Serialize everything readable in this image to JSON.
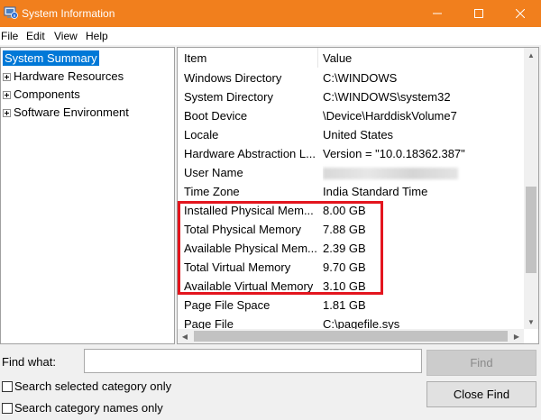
{
  "window": {
    "title": "System Information",
    "controls": {
      "minimize": "—",
      "maximize": "☐",
      "close": "✕"
    }
  },
  "menu": [
    "File",
    "Edit",
    "View",
    "Help"
  ],
  "tree": {
    "selected": "System Summary",
    "children": [
      "Hardware Resources",
      "Components",
      "Software Environment"
    ]
  },
  "table": {
    "columns": [
      "Item",
      "Value"
    ],
    "rows": [
      [
        "Windows Directory",
        "C:\\WINDOWS"
      ],
      [
        "System Directory",
        "C:\\WINDOWS\\system32"
      ],
      [
        "Boot Device",
        "\\Device\\HarddiskVolume7"
      ],
      [
        "Locale",
        "United States"
      ],
      [
        "Hardware Abstraction L...",
        "Version = \"10.0.18362.387\""
      ],
      [
        "User Name",
        ""
      ],
      [
        "Time Zone",
        "India Standard Time"
      ],
      [
        "Installed Physical Mem...",
        "8.00 GB"
      ],
      [
        "Total Physical Memory",
        "7.88 GB"
      ],
      [
        "Available Physical Mem...",
        "2.39 GB"
      ],
      [
        "Total Virtual Memory",
        "9.70 GB"
      ],
      [
        "Available Virtual Memory",
        "3.10 GB"
      ],
      [
        "Page File Space",
        "1.81 GB"
      ],
      [
        "Page File",
        "C:\\pagefile.sys"
      ]
    ],
    "highlight_color": "#e3151e"
  },
  "find": {
    "label": "Find what:",
    "value": "",
    "find_button": "Find",
    "close_button": "Close Find",
    "check_selected": "Search selected category only",
    "check_names": "Search category names only"
  },
  "colors": {
    "titlebar": "#f17f1d",
    "selection": "#0078d7"
  }
}
